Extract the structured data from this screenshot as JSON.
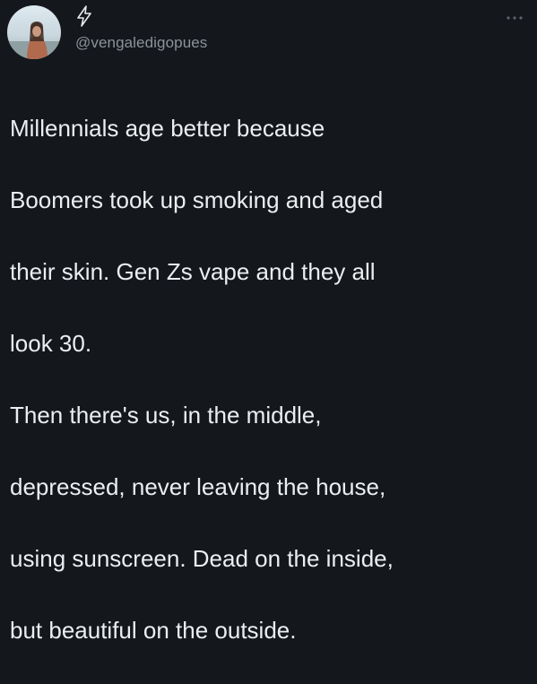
{
  "tweet": {
    "handle": "@vengaledigopues",
    "name_icon": "lightning-bolt-icon",
    "more_icon": "more-options-icon",
    "text_lines": [
      "Millennials age better because",
      "Boomers took up smoking and aged",
      "their skin. Gen Zs vape and they all",
      "look 30.",
      "Then there's us, in the middle,",
      "depressed, never leaving the house,",
      "using sunscreen. Dead on the inside,",
      "but beautiful on the outside."
    ]
  },
  "colors": {
    "background": "#14171c",
    "text": "#eceef0",
    "handle": "#8b929a"
  }
}
